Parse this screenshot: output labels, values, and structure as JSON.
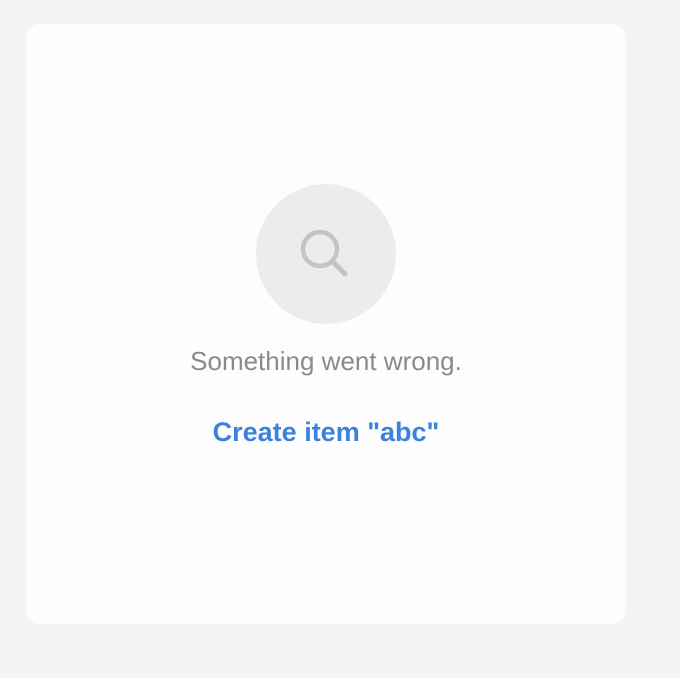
{
  "empty_state": {
    "icon": "search-icon",
    "message": "Something went wrong.",
    "action_label": "Create item \"abc\""
  },
  "colors": {
    "background": "#f3f4f6",
    "panel": "#fdfdfd",
    "icon_circle": "#ececed",
    "icon_stroke": "#c4c4c6",
    "message_text": "#8a8a8a",
    "link": "#3b82dd"
  }
}
